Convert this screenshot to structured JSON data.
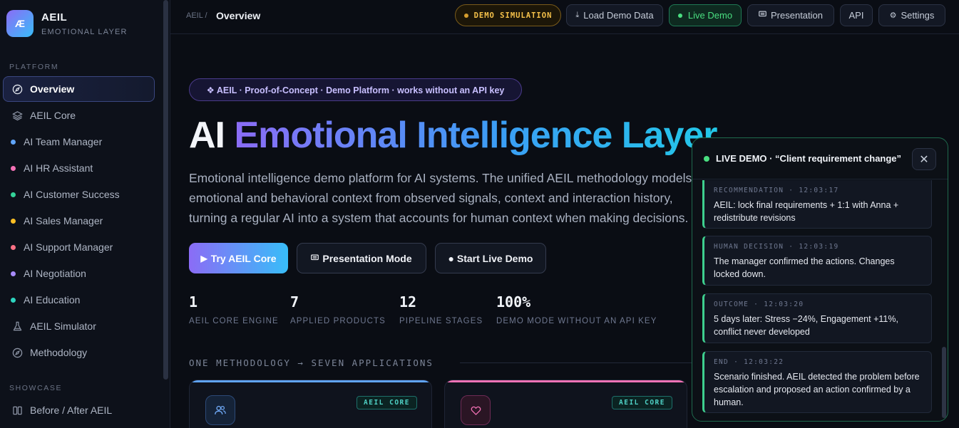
{
  "brand": {
    "logo": "Æ",
    "name": "AEIL",
    "subtitle": "EMOTIONAL LAYER"
  },
  "sidebar": {
    "platform_label": "PLATFORM",
    "showcase_label": "SHOWCASE",
    "items": [
      {
        "label": "Overview",
        "icon": "compass-icon"
      },
      {
        "label": "AEIL Core",
        "icon": "layers-icon"
      },
      {
        "label": "AI Team Manager",
        "color": "#60a5fa"
      },
      {
        "label": "AI HR Assistant",
        "color": "#f472b6"
      },
      {
        "label": "AI Customer Success",
        "color": "#34d399"
      },
      {
        "label": "AI Sales Manager",
        "color": "#fbbf24"
      },
      {
        "label": "AI Support Manager",
        "color": "#fb7185"
      },
      {
        "label": "AI Negotiation",
        "color": "#a78bfa"
      },
      {
        "label": "AI Education",
        "color": "#2dd4bf"
      },
      {
        "label": "AEIL Simulator",
        "icon": "flask-icon"
      },
      {
        "label": "Methodology",
        "icon": "compass-icon"
      },
      {
        "label": "Before / After AEIL",
        "icon": "columns-icon"
      }
    ]
  },
  "topbar": {
    "breadcrumb_root": "AEIL /",
    "breadcrumb_current": "Overview",
    "demo_pill": "DEMO SIMULATION",
    "load_demo": "Load Demo Data",
    "live_demo": "Live Demo",
    "presentation": "Presentation",
    "api": "API",
    "settings": "Settings"
  },
  "hero": {
    "badge": "❖ AEIL · Proof-of-Concept · Demo Platform · works without an API key",
    "title_plain": "AI ",
    "title_gradient": "Emotional Intelligence Layer",
    "desc_lines": [
      "Emotional intelligence demo platform for AI systems. The unified AEIL methodology models",
      "emotional and behavioral context from observed signals, context and interaction history,",
      "turning a regular AI into a system that accounts for human context when making decisions."
    ],
    "cta_primary": "Try AEIL Core",
    "cta_presentation": "Presentation Mode",
    "cta_live": "● Start Live Demo"
  },
  "stats": [
    {
      "value": "1",
      "label": "AEIL CORE ENGINE"
    },
    {
      "value": "7",
      "label": "APPLIED PRODUCTS"
    },
    {
      "value": "12",
      "label": "PIPELINE STAGES"
    },
    {
      "value": "100%",
      "label": "DEMO MODE WITHOUT AN API KEY"
    }
  ],
  "section": {
    "heading": "ONE METHODOLOGY → SEVEN APPLICATIONS"
  },
  "cards": [
    {
      "tag": "AEIL CORE",
      "accent": "#60a5fa",
      "icon": "users-icon"
    },
    {
      "tag": "AEIL CORE",
      "accent": "#f472b6",
      "icon": "heart-icon"
    }
  ],
  "live_panel": {
    "title": "LIVE DEMO · “Client requirement change”",
    "close": "✕",
    "events": [
      {
        "meta": "RECOMMENDATION · 12:03:17",
        "text": "AEIL: lock final requirements + 1:1 with Anna + redistribute revisions"
      },
      {
        "meta": "HUMAN DECISION · 12:03:19",
        "text": "The manager confirmed the actions. Changes locked down."
      },
      {
        "meta": "OUTCOME · 12:03:20",
        "text": "5 days later: Stress −24%, Engagement +11%, conflict never developed"
      },
      {
        "meta": "END · 12:03:22",
        "text": "Scenario finished. AEIL detected the problem before escalation and proposed an action confirmed by a human."
      }
    ]
  }
}
